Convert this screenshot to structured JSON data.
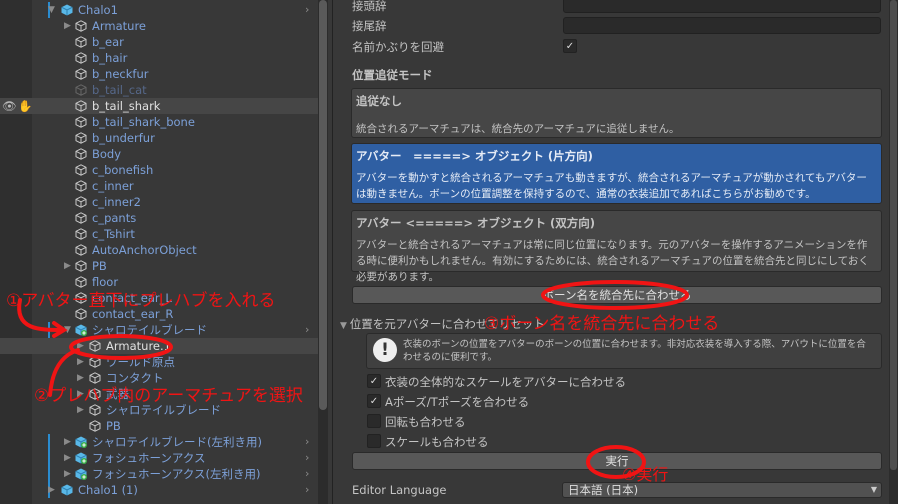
{
  "hierarchy": {
    "rows": [
      {
        "label": "Chalo1",
        "level": 0,
        "expanded": true,
        "prefab": true,
        "chevron": true,
        "bar": true
      },
      {
        "label": "Armature",
        "level": 1,
        "collapsed": true
      },
      {
        "label": "b_ear",
        "level": 1
      },
      {
        "label": "b_hair",
        "level": 1
      },
      {
        "label": "b_neckfur",
        "level": 1
      },
      {
        "label": "b_tail_cat",
        "level": 1,
        "dim": true
      },
      {
        "label": "b_tail_shark",
        "level": 1,
        "hover": true
      },
      {
        "label": "b_tail_shark_bone",
        "level": 1
      },
      {
        "label": "b_underfur",
        "level": 1
      },
      {
        "label": "Body",
        "level": 1
      },
      {
        "label": "c_bonefish",
        "level": 1
      },
      {
        "label": "c_inner",
        "level": 1
      },
      {
        "label": "c_inner2",
        "level": 1
      },
      {
        "label": "c_pants",
        "level": 1
      },
      {
        "label": "c_Tshirt",
        "level": 1
      },
      {
        "label": "AutoAnchorObject",
        "level": 1
      },
      {
        "label": "PB",
        "level": 1,
        "collapsed": true
      },
      {
        "label": "floor",
        "level": 1
      },
      {
        "label": "contact_ear_L",
        "level": 1
      },
      {
        "label": "contact_ear_R",
        "level": 1
      },
      {
        "label": "シャロテイルブレード",
        "level": 1,
        "expanded": true,
        "prefabAdd": true,
        "chevron": true,
        "bar": true
      },
      {
        "label": "Armature.1",
        "level": 2,
        "collapsed": true,
        "selected": true
      },
      {
        "label": "ワールド原点",
        "level": 2,
        "collapsed": true
      },
      {
        "label": "コンタクト",
        "level": 2,
        "collapsed": true
      },
      {
        "label": "武器",
        "level": 2,
        "collapsed": true
      },
      {
        "label": "シャロテイルブレード",
        "level": 2,
        "collapsed": true
      },
      {
        "label": "PB",
        "level": 2
      },
      {
        "label": "シャロテイルブレード(左利き用)",
        "level": 1,
        "collapsed": true,
        "prefabAdd": true,
        "chevron": true,
        "bar": true
      },
      {
        "label": "フォシュホーンアクス",
        "level": 1,
        "collapsed": true,
        "prefabAdd": true,
        "chevron": true,
        "bar": true
      },
      {
        "label": "フォシュホーンアクス(左利き用)",
        "level": 1,
        "collapsed": true,
        "prefabAdd": true,
        "chevron": true,
        "bar": true
      },
      {
        "label": "Chalo1 (1)",
        "level": 0,
        "collapsed": true,
        "prefab": true,
        "chevron": true,
        "bar": true
      }
    ]
  },
  "inspector": {
    "prefix_label": "接頭辞",
    "suffix_label": "接尾辞",
    "avoid_name_label": "名前かぶりを回避",
    "avoid_name_checked": true,
    "mode_header": "位置追従モード",
    "modes": [
      {
        "title": "追従なし",
        "desc": "統合されるアーマチュアは、統合先のアーマチュアに追従しません。",
        "selected": false
      },
      {
        "title": "アバター　=====> オブジェクト (片方向)",
        "desc": "アバターを動かすと統合されるアーマチュアも動きますが、統合されるアーマチュアが動かされてもアバターは動きません。ボーンの位置調整を保持するので、通常の衣装追加であればこちらがお勧めです。",
        "selected": true
      },
      {
        "title": "アバター <=====> オブジェクト (双方向)",
        "desc": "アバターと統合されるアーマチュアは常に同じ位置になります。元のアバターを操作するアニメーションを作る時に便利かもしれません。有効にするためには、統合されるアーマチュアの位置を統合先と同じにしておく必要があります。",
        "selected": false
      }
    ],
    "rename_button": "ボーン名を統合先に合わせる",
    "foldout": "位置を元アバターに合わせてリセット",
    "help": "衣装のボーンの位置をアバターのボーンの位置に合わせます。非対応衣装を導入する際、アバウトに位置を合わせるのに便利です。",
    "options": [
      {
        "label": "衣装の全体的なスケールをアバターに合わせる",
        "checked": true
      },
      {
        "label": "Aポーズ/Tポーズを合わせる",
        "checked": true
      },
      {
        "label": "回転も合わせる",
        "checked": false
      },
      {
        "label": "スケールも合わせる",
        "checked": false
      }
    ],
    "execute_button": "実行",
    "language_label": "Editor Language",
    "language_value": "日本語 (日本)"
  },
  "annotations": {
    "step1": "①アバター直下にプレハブを入れる",
    "step2": "②プレハブ内のアーマチュアを選択",
    "step3": "③ボーン名を統合先に合わせる",
    "step4": "④実行",
    "color": "#f01414"
  }
}
